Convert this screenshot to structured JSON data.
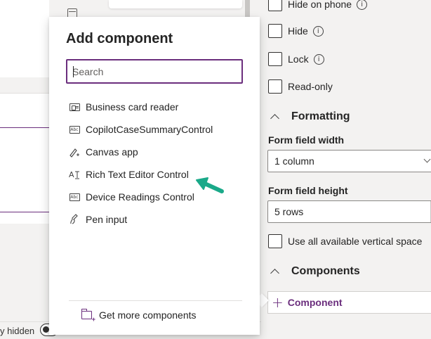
{
  "canvas": {
    "toggle_label": "y hidden"
  },
  "flyout": {
    "title": "Add component",
    "search_placeholder": "Search",
    "items": [
      {
        "label": "Business card reader",
        "icon": "card-icon"
      },
      {
        "label": "CopilotCaseSummaryControl",
        "icon": "abc-icon"
      },
      {
        "label": "Canvas app",
        "icon": "canvas-app-icon"
      },
      {
        "label": "Rich Text Editor Control",
        "icon": "rich-text-icon"
      },
      {
        "label": "Device Readings Control",
        "icon": "abc-icon"
      },
      {
        "label": "Pen input",
        "icon": "pen-icon"
      }
    ],
    "get_more_label": "Get more components"
  },
  "properties": {
    "hide_on_phone_label": "Hide on phone",
    "hide_label": "Hide",
    "lock_label": "Lock",
    "read_only_label": "Read-only",
    "formatting_heading": "Formatting",
    "form_field_width_label": "Form field width",
    "form_field_width_value": "1 column",
    "form_field_height_label": "Form field height",
    "form_field_height_value": "5 rows",
    "use_all_space_label": "Use all available vertical space",
    "components_heading": "Components",
    "add_component_label": "Component",
    "info_glyph": "i"
  },
  "colors": {
    "accent": "#6b2e7d",
    "arrow": "#1aa989"
  }
}
